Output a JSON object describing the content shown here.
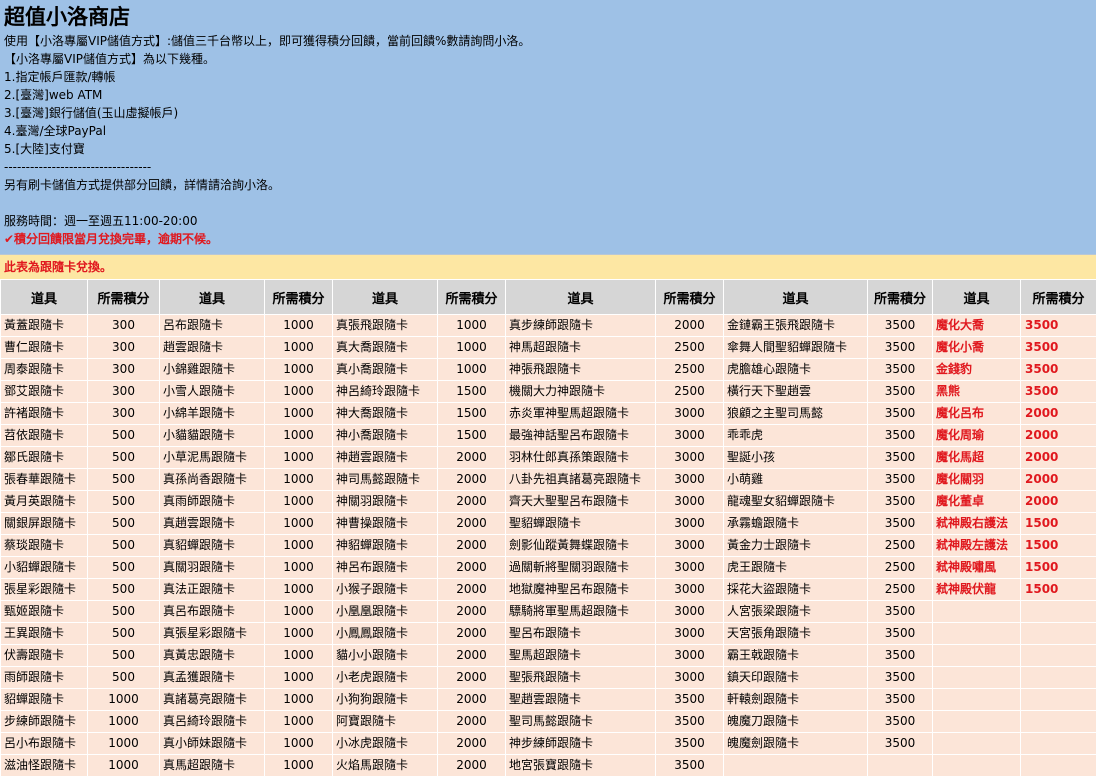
{
  "header": {
    "title": "超值小洛商店",
    "lines": [
      "使用【小洛專屬VIP儲值方式】:儲值三千台幣以上，即可獲得積分回饋，當前回饋%數請詢問小洛。",
      "【小洛專屬VIP儲值方式】為以下幾種。",
      "1.指定帳戶匯款/轉帳",
      "2.[臺灣]web ATM",
      "3.[臺灣]銀行儲值(玉山虛擬帳戶)",
      "4.臺灣/全球PayPal",
      "5.[大陸]支付寶",
      "----------------------------------",
      "另有刷卡儲值方式提供部分回饋，詳情請洽詢小洛。",
      "",
      "服務時間：週一至週五11:00-20:00"
    ],
    "warning": "✔積分回饋限當月兌換完畢，逾期不候。"
  },
  "notice": "此表為跟隨卡兌換。",
  "table": {
    "columns": [
      "道具",
      "所需積分",
      "道具",
      "所需積分",
      "道具",
      "所需積分",
      "道具",
      "所需積分",
      "道具",
      "所需積分",
      "道具",
      "所需積分"
    ],
    "rows": [
      [
        "黃蓋跟隨卡",
        "300",
        "呂布跟隨卡",
        "1000",
        "真張飛跟隨卡",
        "1000",
        "真步練師跟隨卡",
        "2000",
        "金鏈霸王張飛跟隨卡",
        "3500",
        "魔化大喬",
        "3500"
      ],
      [
        "曹仁跟隨卡",
        "300",
        "趙雲跟隨卡",
        "1000",
        "真大喬跟隨卡",
        "1000",
        "神馬超跟隨卡",
        "2500",
        "傘舞人間聖貂蟬跟隨卡",
        "3500",
        "魔化小喬",
        "3500"
      ],
      [
        "周泰跟隨卡",
        "300",
        "小錦雞跟隨卡",
        "1000",
        "真小喬跟隨卡",
        "1000",
        "神張飛跟隨卡",
        "2500",
        "虎膽雄心跟隨卡",
        "3500",
        "金錢豹",
        "3500"
      ],
      [
        "鄧艾跟隨卡",
        "300",
        "小雪人跟隨卡",
        "1000",
        "神呂綺玲跟隨卡",
        "1500",
        "機關大力神跟隨卡",
        "2500",
        "橫行天下聖趙雲",
        "3500",
        "黑熊",
        "3500"
      ],
      [
        "許褚跟隨卡",
        "300",
        "小綿羊跟隨卡",
        "1000",
        "神大喬跟隨卡",
        "1500",
        "赤炎軍神聖馬超跟隨卡",
        "3000",
        "狼顧之主聖司馬懿",
        "3500",
        "魔化呂布",
        "2000"
      ],
      [
        "苕依跟隨卡",
        "500",
        "小貓貓跟隨卡",
        "1000",
        "神小喬跟隨卡",
        "1500",
        "最強神話聖呂布跟隨卡",
        "3000",
        "乖乖虎",
        "3500",
        "魔化周瑜",
        "2000"
      ],
      [
        "鄒氏跟隨卡",
        "500",
        "小草泥馬跟隨卡",
        "1000",
        "神趙雲跟隨卡",
        "2000",
        "羽林仕郎真孫策跟隨卡",
        "3000",
        "聖誕小孩",
        "3500",
        "魔化馬超",
        "2000"
      ],
      [
        "張春華跟隨卡",
        "500",
        "真孫尚香跟隨卡",
        "1000",
        "神司馬懿跟隨卡",
        "2000",
        "八卦先祖真諸葛亮跟隨卡",
        "3000",
        "小萌雞",
        "3500",
        "魔化關羽",
        "2000"
      ],
      [
        "黃月英跟隨卡",
        "500",
        "真雨師跟隨卡",
        "1000",
        "神關羽跟隨卡",
        "2000",
        "齊天大聖聖呂布跟隨卡",
        "3000",
        "龍魂聖女貂蟬跟隨卡",
        "3500",
        "魔化董卓",
        "2000"
      ],
      [
        "關銀屏跟隨卡",
        "500",
        "真趙雲跟隨卡",
        "1000",
        "神曹操跟隨卡",
        "2000",
        "聖貂蟬跟隨卡",
        "3000",
        "承霧蟾跟隨卡",
        "3500",
        "弒神殿右護法",
        "1500"
      ],
      [
        "蔡琰跟隨卡",
        "500",
        "真貂蟬跟隨卡",
        "1000",
        "神貂蟬跟隨卡",
        "2000",
        "劍影仙蹤黃舞蝶跟隨卡",
        "3000",
        "黃金力士跟隨卡",
        "2500",
        "弒神殿左護法",
        "1500"
      ],
      [
        "小貂蟬跟隨卡",
        "500",
        "真關羽跟隨卡",
        "1000",
        "神呂布跟隨卡",
        "2000",
        "過關斬將聖關羽跟隨卡",
        "3000",
        "虎王跟隨卡",
        "2500",
        "弒神殿嘯風",
        "1500"
      ],
      [
        "張星彩跟隨卡",
        "500",
        "真法正跟隨卡",
        "1000",
        "小猴子跟隨卡",
        "2000",
        "地獄魔神聖呂布跟隨卡",
        "3000",
        "採花大盜跟隨卡",
        "2500",
        "弒神殿伏龍",
        "1500"
      ],
      [
        "甄姬跟隨卡",
        "500",
        "真呂布跟隨卡",
        "1000",
        "小凰凰跟隨卡",
        "2000",
        "驃騎將軍聖馬超跟隨卡",
        "3000",
        "人宮張梁跟隨卡",
        "3500",
        "",
        ""
      ],
      [
        "王異跟隨卡",
        "500",
        "真張星彩跟隨卡",
        "1000",
        "小鳳鳳跟隨卡",
        "2000",
        "聖呂布跟隨卡",
        "3000",
        "天宮張角跟隨卡",
        "3500",
        "",
        ""
      ],
      [
        "伏壽跟隨卡",
        "500",
        "真黃忠跟隨卡",
        "1000",
        "貓小小跟隨卡",
        "2000",
        "聖馬超跟隨卡",
        "3000",
        "霸王戟跟隨卡",
        "3500",
        "",
        ""
      ],
      [
        "雨師跟隨卡",
        "500",
        "真孟獲跟隨卡",
        "1000",
        "小老虎跟隨卡",
        "2000",
        "聖張飛跟隨卡",
        "3000",
        "鎮天印跟隨卡",
        "3500",
        "",
        ""
      ],
      [
        "貂蟬跟隨卡",
        "1000",
        "真諸葛亮跟隨卡",
        "1000",
        "小狗狗跟隨卡",
        "2000",
        "聖趙雲跟隨卡",
        "3500",
        "軒轅劍跟隨卡",
        "3500",
        "",
        ""
      ],
      [
        "步練師跟隨卡",
        "1000",
        "真呂綺玲跟隨卡",
        "1000",
        "阿寶跟隨卡",
        "2000",
        "聖司馬懿跟隨卡",
        "3500",
        "魄魔刀跟隨卡",
        "3500",
        "",
        ""
      ],
      [
        "呂小布跟隨卡",
        "1000",
        "真小師妹跟隨卡",
        "1000",
        "小冰虎跟隨卡",
        "2000",
        "神步練師跟隨卡",
        "3500",
        "魄魔劍跟隨卡",
        "3500",
        "",
        ""
      ],
      [
        "滋油怪跟隨卡",
        "1000",
        "真馬超跟隨卡",
        "1000",
        "火焰馬跟隨卡",
        "2000",
        "地宮張寶跟隨卡",
        "3500",
        "",
        "",
        "",
        ""
      ]
    ]
  }
}
